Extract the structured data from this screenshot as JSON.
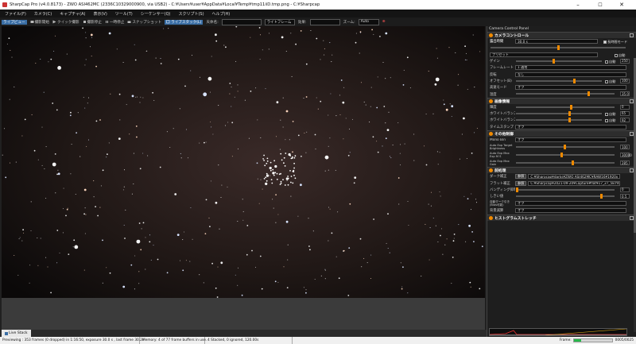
{
  "titlebar": {
    "title": "SharpCap Pro (v4.0.8173) - ZWO ASI462MC (2336C10329000900, via USB2) - C:¥Users¥user¥AppData¥Local¥Temp¥tmp11iiD.tmp.png - C:¥Sharpcap"
  },
  "menubar": {
    "items": [
      "ファイル(F)",
      "カメラ(C)",
      "キャプチャ(A)",
      "表示(V)",
      "ツール(T)",
      "シーケンサー(Q)",
      "スクリプト(S)",
      "ヘルプ(H)"
    ]
  },
  "toolbar": {
    "live_view": "ライブビュー",
    "record": "撮影開始",
    "quick": "クイック撮影",
    "stop": "撮影停止",
    "pause": "一時停止",
    "snapshot": "スナップショット",
    "live_stack": "ライブスタック(L)",
    "target_label": "天体名:",
    "frame_label": "ライトフレーム",
    "effect_label": "効果:",
    "zoom_label": "ズーム:",
    "zoom_value": "Auto"
  },
  "panel": {
    "title": "Camera Control Panel",
    "camera_control": {
      "header": "カメラコントロール",
      "exposure_label": "露出時間",
      "exposure_value": "30.0 s",
      "long_mode": "長時間モード",
      "preset_label": "プリセット",
      "auto_label": "自動",
      "gain_label": "ゲイン",
      "gain_value": "250",
      "framerate_label": "フレームレート",
      "framerate_value": "1 通常",
      "flip_label": "反転",
      "flip_value": "なし",
      "offset_label": "オフセット(B)",
      "offset_value": "100",
      "speed_label": "高速モード",
      "speed_value": "オフ",
      "temp_label": "温度",
      "temp_value": "35.0"
    },
    "image_info": {
      "header": "画像情報",
      "gamma_label": "輝度",
      "gamma_value": "0",
      "wb_red_label": "ホワイトバランス(赤)",
      "wb_red_value": "65",
      "wb_blue_label": "ホワイトバランス(青)",
      "wb_blue_value": "92",
      "timestamp_label": "タイムスタンプ",
      "timestamp_value": "オフ"
    },
    "auto_exposure": {
      "header": "その他制御",
      "mono_bin_label": "Mono Bin",
      "mono_bin_value": "オフ",
      "target_bright_label": "Auto Exp Target Brightness",
      "target_bright_value": "100",
      "max_gain_label": "Auto Exp Max Exp M S",
      "max_gain_value": "30000",
      "max_exp_label": "Auto Exp Max Gain",
      "max_exp_value": "285"
    },
    "preprocessing": {
      "header": "前処理",
      "dark_label": "ダーク補正",
      "dark_btn": "参照",
      "dark_path": "C:¥Sharpcap¥darks¥ZWO ASI462MC¥RAW16¥1920x",
      "flat_label": "フラット補正",
      "flat_btn": "参照",
      "flat_path": "C:¥Sharpcap¥2021-09-20¥Capture¥flat¥17_27_58.fits",
      "banding_label": "バンディング抑制",
      "banding_value": "0",
      "threshold_label": "しきい値",
      "threshold_value": "0.5",
      "autodark_label": "自動ダーク引き(Bias可能)",
      "autodark_value": "オフ",
      "hotpix_label": "背景減算",
      "hotpix_value": "オフ"
    },
    "histogram": {
      "header": "ヒストグラムストレッチ"
    }
  },
  "bottom": {
    "tab_label": "Live Stack"
  },
  "status": {
    "preview": "Previewing : 353 frames (0 dropped) in 1:16:50, exposure 30.0 s , last frame 30.2s",
    "memory": "Memory: 4 of 77 frame buffers in use.",
    "stacked": "4 Stacked, 0 ignored, 120.00s",
    "frames_label": "Frame:",
    "frames_value": "0005/0025",
    "progress_fraction": 0.2
  },
  "colors": {
    "accent": "#f08a00",
    "active_btn": "#3a6ea5",
    "progress": "#27b84a"
  }
}
